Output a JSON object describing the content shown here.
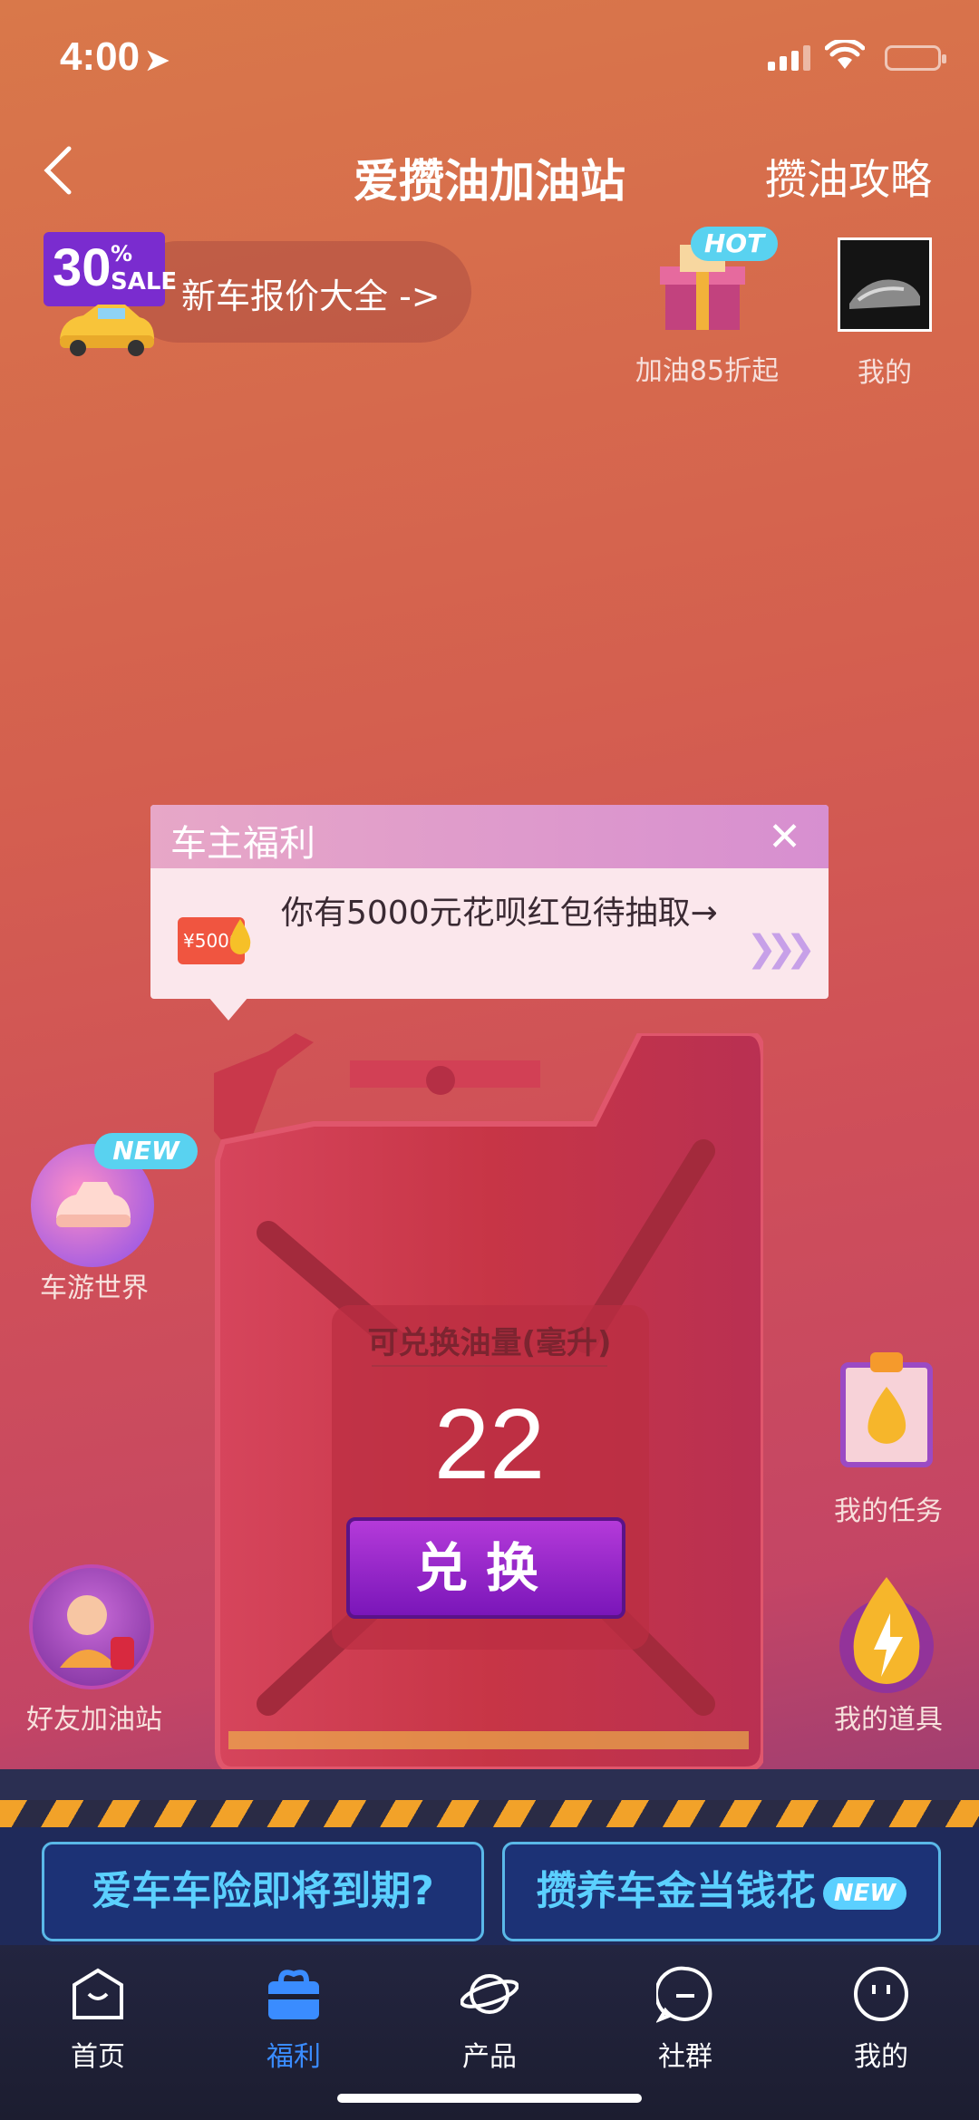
{
  "status_bar": {
    "time": "4:00"
  },
  "header": {
    "title": "爱攒油加油站",
    "right_link": "攒油攻略"
  },
  "promo": {
    "badge_number": "30",
    "badge_percent": "%",
    "badge_sale": "SALE",
    "text": "新车报价大全 ->"
  },
  "top_right": {
    "hot_badge": "HOT",
    "gift_label": "加油85折起",
    "mine_label": "我的"
  },
  "tooltip_card": {
    "title": "车主福利",
    "coupon_value": "¥5000",
    "message": "你有5000元花呗红包待抽取→"
  },
  "jerrycan": {
    "label": "可兑换油量(毫升)",
    "value": "22",
    "button": "兑换"
  },
  "side_items": {
    "car_world_new": "NEW",
    "car_world": "车游世界",
    "friend_station": "好友加油站",
    "my_tasks": "我的任务",
    "my_tools": "我的道具"
  },
  "banners": {
    "left": "爱车车险即将到期?",
    "right": "攒养车金当钱花",
    "right_badge": "NEW"
  },
  "tabbar": [
    {
      "label": "首页",
      "icon": "home-icon"
    },
    {
      "label": "福利",
      "icon": "gift-bag-icon"
    },
    {
      "label": "产品",
      "icon": "planet-icon"
    },
    {
      "label": "社群",
      "icon": "chat-icon"
    },
    {
      "label": "我的",
      "icon": "smile-icon"
    }
  ],
  "colors": {
    "accent_blue": "#3a8cff",
    "badge_cyan": "#59d2f0",
    "button_purple": "#8a1fc4"
  }
}
